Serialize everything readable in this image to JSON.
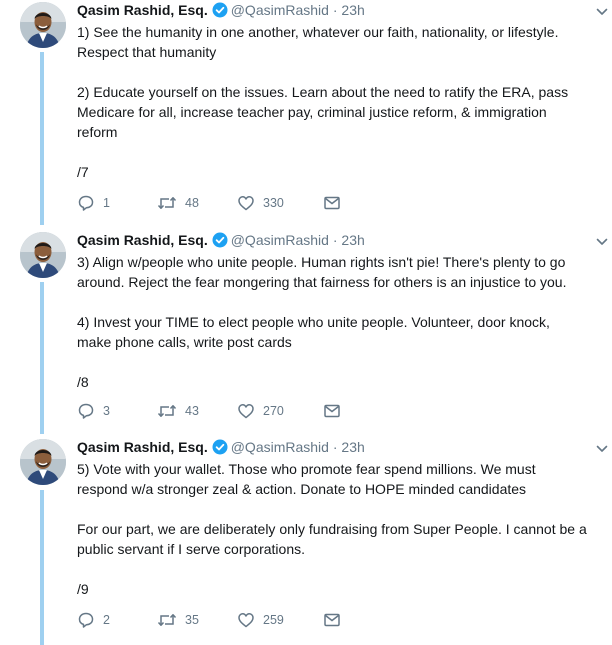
{
  "colors": {
    "thread_line": "#9fd0f0",
    "verified": "#1da1f2",
    "muted": "#657786"
  },
  "tweets": [
    {
      "name": "Qasim Rashid, Esq.",
      "handle": "@QasimRashid",
      "dot": "·",
      "time": "23h",
      "text": "1) See the humanity in one another, whatever our faith, nationality, or lifestyle. Respect that humanity\n\n2) Educate yourself on the issues. Learn about the need to ratify the ERA, pass Medicare for all, increase teacher pay, criminal justice reform, & immigration reform\n\n/7",
      "replies": "1",
      "retweets": "48",
      "likes": "330"
    },
    {
      "name": "Qasim Rashid, Esq.",
      "handle": "@QasimRashid",
      "dot": "·",
      "time": "23h",
      "text": "3) Align w/people who unite people. Human rights isn't pie! There's plenty to go around. Reject the fear mongering that fairness for others is an injustice to you.\n\n4) Invest your TIME to elect people who unite people. Volunteer, door knock, make phone calls, write post cards\n\n/8",
      "replies": "3",
      "retweets": "43",
      "likes": "270"
    },
    {
      "name": "Qasim Rashid, Esq.",
      "handle": "@QasimRashid",
      "dot": "·",
      "time": "23h",
      "text": "5) Vote with your wallet. Those who promote fear spend millions. We must respond w/a stronger zeal & action. Donate to HOPE minded candidates\n\nFor our part, we are deliberately only fundraising from Super People. I cannot be a public servant if I serve corporations.\n\n/9",
      "replies": "2",
      "retweets": "35",
      "likes": "259"
    }
  ]
}
